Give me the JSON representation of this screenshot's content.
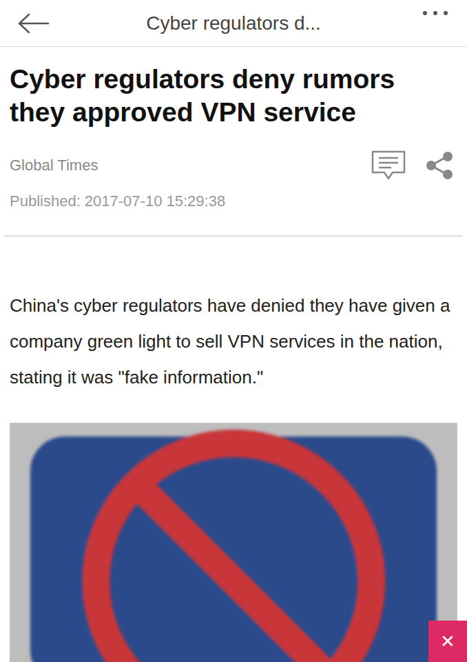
{
  "top_bar": {
    "title": "Cyber regulators d..."
  },
  "article": {
    "headline": "Cyber regulators deny rumors they approved VPN service",
    "source": "Global Times",
    "published": "Published: 2017-07-10 15:29:38",
    "body": "China's cyber regulators have denied they have given a company green light to sell VPN services in the nation, stating it was \"fake information.\""
  },
  "ad_close": {
    "label": "✕"
  }
}
